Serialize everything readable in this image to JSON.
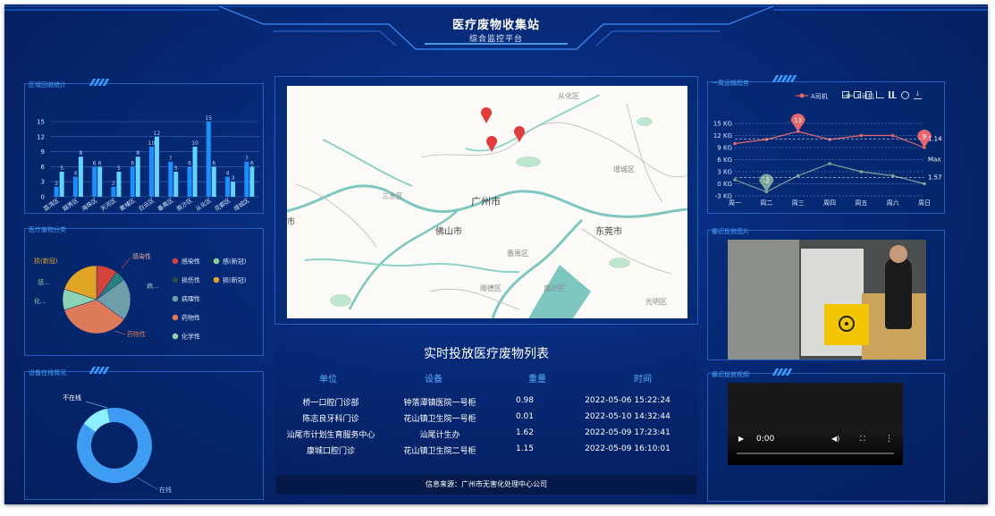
{
  "header": {
    "title": "医疗废物收集站",
    "subtitle": "综合监控平台"
  },
  "left": {
    "region_title": "区域回收统计",
    "region_chart": {
      "type": "bar",
      "categories": [
        "荔湾区",
        "越秀区",
        "海珠区",
        "天河区",
        "黄埔区",
        "白云区",
        "番禺区",
        "南沙区",
        "从化区",
        "花都区",
        "增城区"
      ],
      "series": [
        {
          "values": [
            2,
            4,
            6,
            2,
            6,
            10,
            7,
            6,
            15,
            4,
            7
          ]
        },
        {
          "values": [
            5,
            8,
            6,
            5,
            8,
            12,
            5,
            10,
            6,
            3,
            6
          ]
        }
      ],
      "ylim": [
        0,
        15
      ],
      "yticks": [
        "0",
        "3",
        "6",
        "9",
        "12",
        "15"
      ],
      "colors": [
        "#1b8fff",
        "#61d4ff"
      ]
    },
    "type_title": "医疗废物分类",
    "type_chart": {
      "type": "pie",
      "slices": [
        {
          "label": "感染性",
          "value": 10,
          "color": "#d6433a"
        },
        {
          "label": "感(新冠)",
          "value": 5,
          "color": "#2b7e7e"
        },
        {
          "label": "损伤性",
          "value": 20,
          "color": "#6f9fa9"
        },
        {
          "label": "药物性",
          "value": 35,
          "color": "#dc7a5a"
        },
        {
          "label": "化学性",
          "value": 10,
          "color": "#8ad3b5"
        },
        {
          "label": "损(新冠)",
          "value": 20,
          "color": "#e0a525"
        }
      ],
      "outer_labels": {
        "s0": "感染性",
        "s1": "感...",
        "s2": "病...",
        "s3": "药物性",
        "s4": "化...",
        "s5": "损(新冠)",
        "s6": "感..."
      },
      "legend": [
        {
          "label": "感染性",
          "color": "#d6433a"
        },
        {
          "label": "感(新冠)",
          "color": "#8fcf95"
        },
        {
          "label": "损伤性",
          "color": "#2c4a3f"
        },
        {
          "label": "损(新冠)",
          "color": "#e0a525"
        },
        {
          "label": "病理性",
          "color": "#6f9fa9"
        },
        {
          "label": "药物性",
          "color": "#dc7a5a"
        },
        {
          "label": "化学性",
          "color": "#8ad3b5"
        }
      ]
    },
    "online_title": "设备在线情况",
    "online_chart": {
      "type": "pie",
      "slices": [
        {
          "label": "在线",
          "value": 88,
          "color": "#3f9cf3"
        },
        {
          "label": "不在线",
          "value": 12,
          "color": "#8af0ff"
        }
      ]
    }
  },
  "map": {
    "labels": {
      "conghua": "从化区",
      "sanshui": "三水区",
      "guangzhou": "广州市",
      "zengcheng": "增城区",
      "foshan": "佛山市",
      "dongguan": "东莞市",
      "panyu": "番禺区",
      "shunde": "顺德区",
      "nansha": "南沙区",
      "guangming": "光明区",
      "shi": "市"
    }
  },
  "table": {
    "title": "实时投放医疗废物列表",
    "headers": [
      "单位",
      "设备",
      "重量",
      "时间"
    ],
    "rows": [
      [
        "桥一口腔门诊部",
        "钟落潭镇医院一号柜",
        "0.98",
        "2022-05-06 15:22:24"
      ],
      [
        "陈志良牙科门诊",
        "花山镇卫生院一号柜",
        "0.01",
        "2022-05-10 14:32:44"
      ],
      [
        "汕尾市计划生育服务中心",
        "汕尾计生办",
        "1.62",
        "2022-05-09 17:23:41"
      ],
      [
        "康城口腔门诊",
        "花山镇卫生院二号柜",
        "1.15",
        "2022-05-09 16:10:01"
      ]
    ],
    "source": "信息来源：广州市无害化处理中心公司"
  },
  "right": {
    "weekly_title": "一周运输趋势",
    "weekly_chart": {
      "type": "line",
      "categories": [
        "周一",
        "周二",
        "周三",
        "周四",
        "周五",
        "周六",
        "周日"
      ],
      "series": [
        {
          "name": "A司机",
          "values": [
            10,
            11,
            13,
            11,
            12,
            12,
            9
          ],
          "color": "#e4676d"
        },
        {
          "name": "B司机",
          "values": [
            1,
            -2,
            2,
            5,
            3,
            2,
            0
          ],
          "color": "#7fa69a"
        }
      ],
      "ylim": [
        -3,
        15
      ],
      "yticks": [
        "-3 KG",
        "0 KG",
        "3 KG",
        "6 KG",
        "9 KG",
        "12 KG",
        "15 KG"
      ],
      "max_pin_a": "13",
      "min_pin_a": "9",
      "min_pin_b": "-2",
      "avg_a_label": "1.14",
      "avg_b_label": "1.57",
      "max_label": "Max"
    },
    "photo_title": "最近投放图片",
    "video_title": "最近投放视频",
    "video_time": "0:00"
  }
}
